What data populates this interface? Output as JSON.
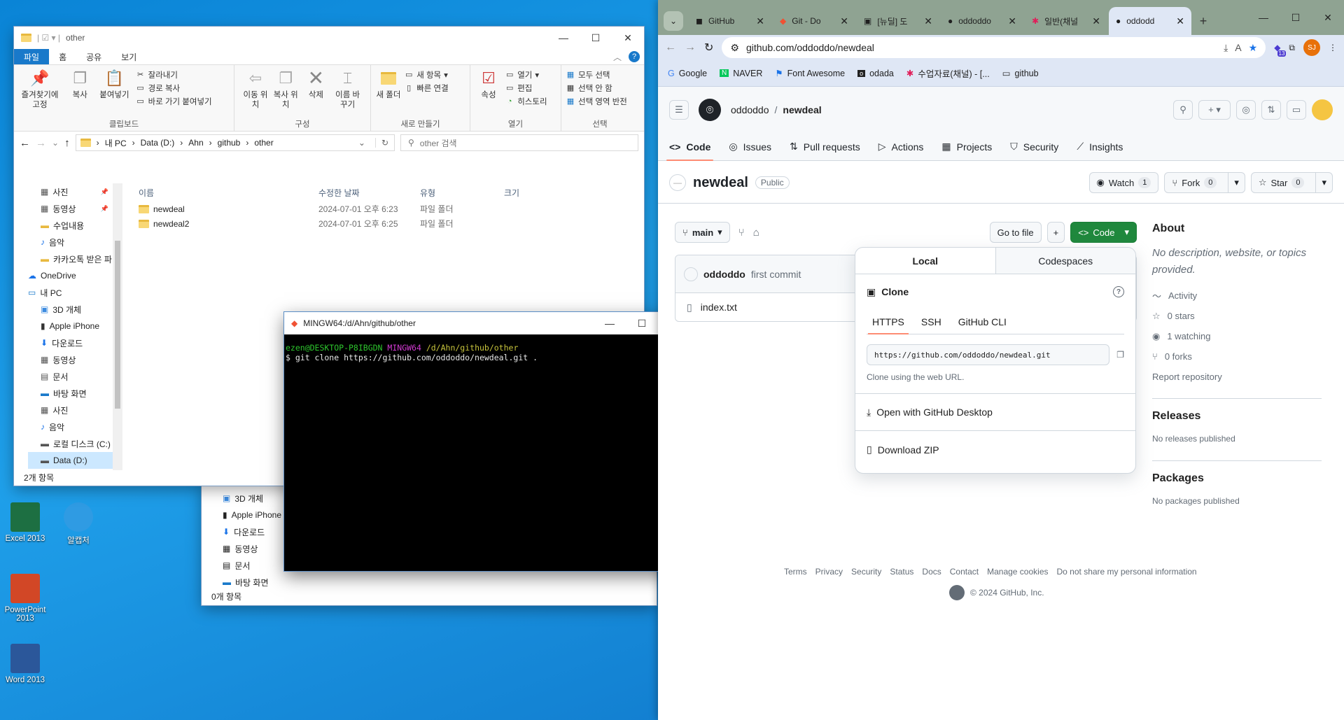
{
  "desktop": {
    "icons": [
      {
        "label": "Excel 2013",
        "color": "#1d6f42"
      },
      {
        "label": "알캡처",
        "color": "#2f9be3"
      },
      {
        "label": "PowerPoint 2013",
        "color": "#d24726"
      },
      {
        "label": "Word 2013",
        "color": "#2b579a"
      }
    ]
  },
  "explorer": {
    "title": "other",
    "tabs": [
      "파일",
      "홈",
      "공유",
      "보기"
    ],
    "ribbon": {
      "clipboard": {
        "pin": "즐겨찾기에 고정",
        "copy": "복사",
        "paste": "붙여넣기",
        "cut": "잘라내기",
        "copy_path": "경로 복사",
        "paste_shortcut": "바로 가기 붙여넣기",
        "name": "클립보드"
      },
      "organize": {
        "move": "이동 위치",
        "copyto": "복사 위치",
        "delete": "삭제",
        "rename": "이름 바꾸기",
        "name": "구성"
      },
      "new": {
        "folder": "새 폴더",
        "item": "새 항목",
        "easy": "빠른 연결",
        "name": "새로 만들기"
      },
      "open": {
        "props": "속성",
        "open": "열기",
        "edit": "편집",
        "history": "히스토리",
        "name": "열기"
      },
      "select": {
        "all": "모두 선택",
        "none": "선택 안 함",
        "invert": "선택 영역 반전",
        "name": "선택"
      }
    },
    "breadcrumb": [
      "내 PC",
      "Data (D:)",
      "Ahn",
      "github",
      "other"
    ],
    "search_placeholder": "other 검색",
    "nav": [
      {
        "label": "사진",
        "pinned": true
      },
      {
        "label": "동영상",
        "pinned": true
      },
      {
        "label": "수업내용",
        "pinned": false
      },
      {
        "label": "음악",
        "pinned": false
      },
      {
        "label": "카카오톡 받은 파",
        "pinned": false
      },
      {
        "label": "OneDrive",
        "pinned": false
      },
      {
        "label": "내 PC",
        "pinned": false
      },
      {
        "label": "3D 개체",
        "pinned": false
      },
      {
        "label": "Apple iPhone",
        "pinned": false
      },
      {
        "label": "다운로드",
        "pinned": false
      },
      {
        "label": "동영상",
        "pinned": false
      },
      {
        "label": "문서",
        "pinned": false
      },
      {
        "label": "바탕 화면",
        "pinned": false
      },
      {
        "label": "사진",
        "pinned": false
      },
      {
        "label": "음악",
        "pinned": false
      },
      {
        "label": "로컬 디스크 (C:)",
        "pinned": false
      },
      {
        "label": "Data (D:)",
        "pinned": false
      }
    ],
    "columns": [
      "이름",
      "수정한 날짜",
      "유형",
      "크기"
    ],
    "files": [
      {
        "name": "newdeal",
        "date": "2024-07-01 오후 6:23",
        "type": "파일 폴더"
      },
      {
        "name": "newdeal2",
        "date": "2024-07-01 오후 6:25",
        "type": "파일 폴더"
      }
    ],
    "status": "2개 항목"
  },
  "explorer2": {
    "nav": [
      "3D 개체",
      "Apple iPhone",
      "다운로드",
      "동영상",
      "문서",
      "바탕 화면"
    ],
    "status": "0개 항목"
  },
  "terminal": {
    "title": "MINGW64:/d/Ahn/github/other",
    "prompt_user": "ezen@DESKTOP-P8IBGDN",
    "prompt_env": "MINGW64",
    "prompt_path": "/d/Ahn/github/other",
    "command": "$ git clone https://github.com/oddoddo/newdeal.git ."
  },
  "chrome": {
    "tabs": [
      "GitHub",
      "Git - Do",
      "[뉴딜] 도",
      "oddoddo",
      "일반(채널",
      "oddodd"
    ],
    "url": "github.com/oddoddo/newdeal",
    "ext_badge": "13",
    "profile": "SJ",
    "bookmarks": [
      "Google",
      "NAVER",
      "Font Awesome",
      "odada",
      "수업자료(채널) - [...",
      "github"
    ]
  },
  "github": {
    "owner": "oddoddo",
    "repo": "newdeal",
    "nav": [
      "Code",
      "Issues",
      "Pull requests",
      "Actions",
      "Projects",
      "Security",
      "Insights"
    ],
    "visibility": "Public",
    "watch": {
      "label": "Watch",
      "count": "1"
    },
    "fork": {
      "label": "Fork",
      "count": "0"
    },
    "star": {
      "label": "Star",
      "count": "0"
    },
    "branch": "main",
    "go_to_file": "Go to file",
    "code_btn": "Code",
    "commit_author": "oddoddo",
    "commit_msg": "first commit",
    "file": "index.txt",
    "popover": {
      "tabs": [
        "Local",
        "Codespaces"
      ],
      "clone_title": "Clone",
      "protocols": [
        "HTTPS",
        "SSH",
        "GitHub CLI"
      ],
      "clone_url": "https://github.com/oddoddo/newdeal.git",
      "hint": "Clone using the web URL.",
      "open_desktop": "Open with GitHub Desktop",
      "download": "Download ZIP"
    },
    "about": {
      "title": "About",
      "desc": "No description, website, or topics provided.",
      "activity": "Activity",
      "stars": "0 stars",
      "watching": "1 watching",
      "forks": "0 forks",
      "report": "Report repository"
    },
    "releases": {
      "title": "Releases",
      "text": "No releases published"
    },
    "packages": {
      "title": "Packages",
      "text": "No packages published"
    },
    "footer": [
      "Terms",
      "Privacy",
      "Security",
      "Status",
      "Docs",
      "Contact",
      "Manage cookies",
      "Do not share my personal information"
    ],
    "copyright": "© 2024 GitHub, Inc."
  }
}
